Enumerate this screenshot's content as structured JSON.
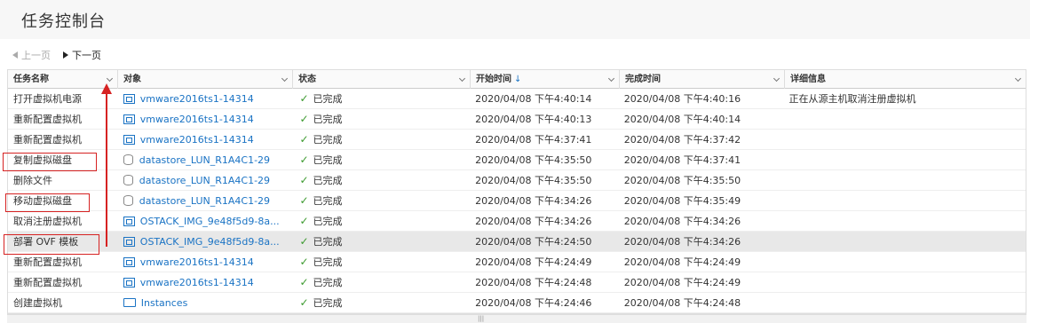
{
  "page": {
    "title": "任务控制台"
  },
  "pager": {
    "prev": "上一页",
    "next": "下一页"
  },
  "columns": [
    {
      "label": "任务名称"
    },
    {
      "label": "对象"
    },
    {
      "label": "状态"
    },
    {
      "label": "开始时间",
      "sort": "↓"
    },
    {
      "label": "完成时间"
    },
    {
      "label": "详细信息"
    }
  ],
  "rows": [
    {
      "task": "打开虚拟机电源",
      "object": "vmware2016ts1-14314",
      "object_type": "vm",
      "status": "已完成",
      "start": "2020/04/08 下午4:40:14",
      "end": "2020/04/08 下午4:40:16",
      "details": "正在从源主机取消注册虚拟机"
    },
    {
      "task": "重新配置虚拟机",
      "object": "vmware2016ts1-14314",
      "object_type": "vm",
      "status": "已完成",
      "start": "2020/04/08 下午4:40:13",
      "end": "2020/04/08 下午4:40:14",
      "details": ""
    },
    {
      "task": "重新配置虚拟机",
      "object": "vmware2016ts1-14314",
      "object_type": "vm",
      "status": "已完成",
      "start": "2020/04/08 下午4:37:41",
      "end": "2020/04/08 下午4:37:42",
      "details": ""
    },
    {
      "task": "复制虚拟磁盘",
      "object": "datastore_LUN_R1A4C1-29",
      "object_type": "datastore",
      "status": "已完成",
      "start": "2020/04/08 下午4:35:50",
      "end": "2020/04/08 下午4:37:41",
      "details": ""
    },
    {
      "task": "删除文件",
      "object": "datastore_LUN_R1A4C1-29",
      "object_type": "datastore",
      "status": "已完成",
      "start": "2020/04/08 下午4:35:50",
      "end": "2020/04/08 下午4:35:50",
      "details": ""
    },
    {
      "task": "移动虚拟磁盘",
      "object": "datastore_LUN_R1A4C1-29",
      "object_type": "datastore",
      "status": "已完成",
      "start": "2020/04/08 下午4:34:26",
      "end": "2020/04/08 下午4:35:49",
      "details": ""
    },
    {
      "task": "取消注册虚拟机",
      "object": "OSTACK_IMG_9e48f5d9-8a...",
      "object_type": "vm",
      "status": "已完成",
      "start": "2020/04/08 下午4:34:26",
      "end": "2020/04/08 下午4:34:26",
      "details": ""
    },
    {
      "task": "部署 OVF 模板",
      "object": "OSTACK_IMG_9e48f5d9-8a...",
      "object_type": "vm",
      "status": "已完成",
      "start": "2020/04/08 下午4:24:50",
      "end": "2020/04/08 下午4:34:26",
      "details": "",
      "selected": true
    },
    {
      "task": "重新配置虚拟机",
      "object": "vmware2016ts1-14314",
      "object_type": "vm",
      "status": "已完成",
      "start": "2020/04/08 下午4:24:49",
      "end": "2020/04/08 下午4:24:49",
      "details": ""
    },
    {
      "task": "重新配置虚拟机",
      "object": "vmware2016ts1-14314",
      "object_type": "vm",
      "status": "已完成",
      "start": "2020/04/08 下午4:24:48",
      "end": "2020/04/08 下午4:24:49",
      "details": ""
    },
    {
      "task": "创建虚拟机",
      "object": "Instances",
      "object_type": "folder",
      "status": "已完成",
      "start": "2020/04/08 下午4:24:46",
      "end": "2020/04/08 下午4:24:48",
      "details": ""
    }
  ],
  "colors": {
    "link": "#1a73c4",
    "success": "#3c9a2f",
    "annotation": "#d62222",
    "selected_row": "#e8e8e8"
  }
}
